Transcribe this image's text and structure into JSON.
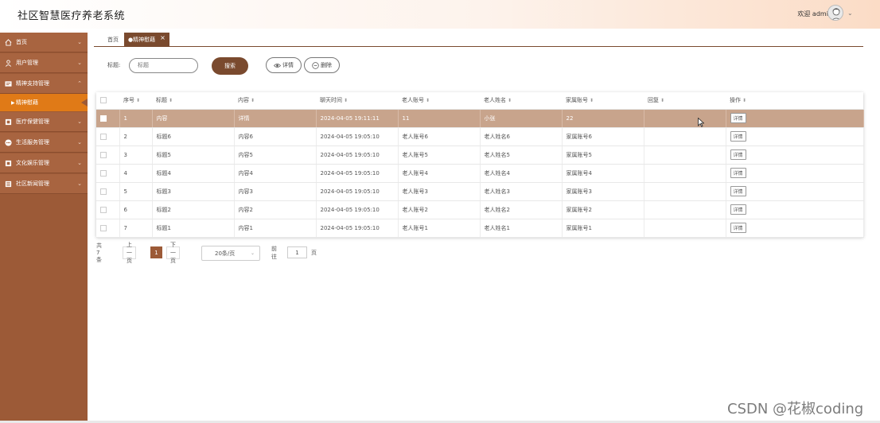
{
  "header": {
    "title": "社区智慧医疗养老系统",
    "welcome": "欢迎 admin"
  },
  "sidebar": {
    "items": [
      {
        "label": "首页",
        "icon": "home-icon"
      },
      {
        "label": "用户管理",
        "icon": "user-icon"
      },
      {
        "label": "精神支持管理",
        "icon": "heart-card-icon"
      },
      {
        "label": "精神慰藉",
        "icon": "arrow-right-icon",
        "active": true
      },
      {
        "label": "医疗保健管理",
        "icon": "medical-icon"
      },
      {
        "label": "生活服务管理",
        "icon": "service-icon"
      },
      {
        "label": "文化娱乐管理",
        "icon": "culture-icon"
      },
      {
        "label": "社区新闻管理",
        "icon": "news-icon"
      }
    ]
  },
  "tabs": [
    {
      "label": "首页"
    },
    {
      "label": "●精神慰藉"
    }
  ],
  "search": {
    "label": "标题:",
    "placeholder": "标题",
    "search_button": "搜索",
    "detail_button": "详情",
    "delete_button": "删除"
  },
  "table": {
    "columns": [
      "序号",
      "标题",
      "内容",
      "聊天时间",
      "老人账号",
      "老人姓名",
      "家属账号",
      "回复",
      "操作"
    ],
    "rows": [
      {
        "no": "1",
        "title": "内容",
        "content": "详情",
        "time": "2024-04-05 19:11:11",
        "account": "11",
        "name": "小张",
        "family": "22",
        "reply": "",
        "action": "详情"
      },
      {
        "no": "2",
        "title": "标题6",
        "content": "内容6",
        "time": "2024-04-05 19:05:10",
        "account": "老人账号6",
        "name": "老人姓名6",
        "family": "家属账号6",
        "reply": "",
        "action": "详情"
      },
      {
        "no": "3",
        "title": "标题5",
        "content": "内容5",
        "time": "2024-04-05 19:05:10",
        "account": "老人账号5",
        "name": "老人姓名5",
        "family": "家属账号5",
        "reply": "",
        "action": "详情"
      },
      {
        "no": "4",
        "title": "标题4",
        "content": "内容4",
        "time": "2024-04-05 19:05:10",
        "account": "老人账号4",
        "name": "老人姓名4",
        "family": "家属账号4",
        "reply": "",
        "action": "详情"
      },
      {
        "no": "5",
        "title": "标题3",
        "content": "内容3",
        "time": "2024-04-05 19:05:10",
        "account": "老人账号3",
        "name": "老人姓名3",
        "family": "家属账号3",
        "reply": "",
        "action": "详情"
      },
      {
        "no": "6",
        "title": "标题2",
        "content": "内容2",
        "time": "2024-04-05 19:05:10",
        "account": "老人账号2",
        "name": "老人姓名2",
        "family": "家属账号2",
        "reply": "",
        "action": "详情"
      },
      {
        "no": "7",
        "title": "标题1",
        "content": "内容1",
        "time": "2024-04-05 19:05:10",
        "account": "老人账号1",
        "name": "老人姓名1",
        "family": "家属账号1",
        "reply": "",
        "action": "详情"
      }
    ]
  },
  "pagination": {
    "total": "共 7 条",
    "prev": "上一页",
    "current": "1",
    "next": "下一页",
    "page_size": "20条/页",
    "goto_label": "前往",
    "goto_value": "1",
    "page_unit": "页"
  },
  "watermark": "CSDN @花椒coding",
  "colors": {
    "sidebar": "#9c5a37",
    "accent": "#7a4a2e",
    "active_menu": "#e07a17",
    "selected_row": "#c8a48c"
  }
}
